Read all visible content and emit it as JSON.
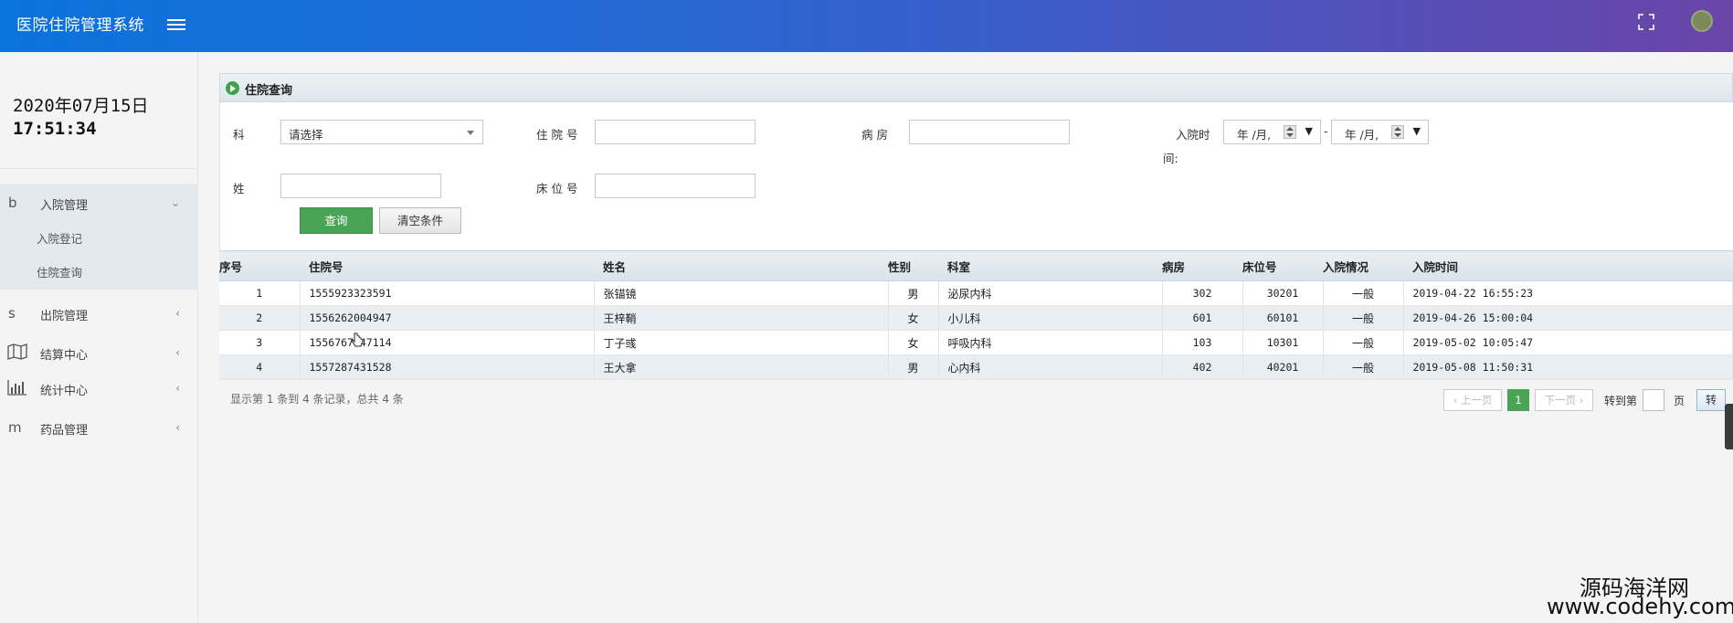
{
  "header": {
    "title": "医院住院管理系统",
    "menu_icon": "hamburger-icon",
    "fullscreen_icon": "expand-icon"
  },
  "sidebar": {
    "date": "2020年07月15日",
    "time": "17:51:34",
    "groups": [
      {
        "letter": "b",
        "label": "入院管理",
        "open": true,
        "arrow": "⌄",
        "items": [
          "入院登记",
          "住院查询"
        ]
      },
      {
        "letter": "s",
        "label": "出院管理",
        "arrow": "‹"
      },
      {
        "icon": "map-icon",
        "label": "结算中心",
        "arrow": "‹"
      },
      {
        "icon": "bar-chart-icon",
        "label": "统计中心",
        "arrow": "‹"
      },
      {
        "letter": "m",
        "label": "药品管理",
        "arrow": "‹"
      }
    ]
  },
  "panel": {
    "title": "住院查询"
  },
  "form": {
    "dept_label": "科",
    "dept_value": "请选择",
    "admission_no_label": "住 院 号",
    "ward_label": "病 房",
    "admit_time_label_1": "入院时",
    "admit_time_label_2": "间:",
    "date_from": "年 /月,",
    "date_sep": "-",
    "date_to": "年 /月,",
    "name_label": "姓",
    "bed_label": "床 位 号",
    "search_button": "查询",
    "clear_button": "清空条件"
  },
  "table": {
    "headers": [
      "序号",
      "住院号",
      "姓名",
      "性别",
      "科室",
      "病房",
      "床位号",
      "入院情况",
      "入院时间"
    ],
    "rows": [
      [
        "1",
        "1555923323591",
        "张锚镜",
        "男",
        "泌尿内科",
        "302",
        "30201",
        "一般",
        "2019-04-22 16:55:23"
      ],
      [
        "2",
        "1556262004947",
        "王梓鞘",
        "女",
        "小儿科",
        "601",
        "60101",
        "一般",
        "2019-04-26 15:00:04"
      ],
      [
        "3",
        "1556767647114",
        "丁子彧",
        "女",
        "呼吸内科",
        "103",
        "10301",
        "一般",
        "2019-05-02 10:05:47"
      ],
      [
        "4",
        "1557287431528",
        "王大拿",
        "男",
        "心内科",
        "402",
        "40201",
        "一般",
        "2019-05-08 11:50:31"
      ]
    ]
  },
  "pagination": {
    "info": "显示第 1 条到 4 条记录，总共 4 条",
    "prev": "‹ 上一页",
    "current": "1",
    "next": "下一页 ›",
    "goto_prefix": "转到第",
    "goto_suffix": "页",
    "go": "转"
  },
  "watermark": {
    "line1": "源码海洋网",
    "line2": "www.codehy.com"
  }
}
